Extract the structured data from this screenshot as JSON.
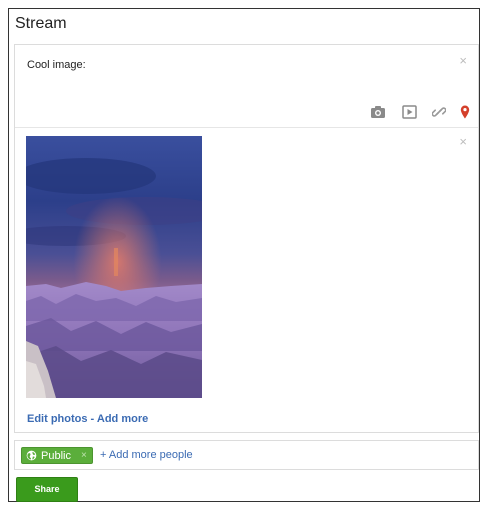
{
  "stream": {
    "title": "Stream"
  },
  "composer": {
    "text": "Cool image:",
    "close_glyph": "×",
    "tools": [
      {
        "name": "camera-icon"
      },
      {
        "name": "video-icon"
      },
      {
        "name": "link-icon"
      },
      {
        "name": "location-pin-icon"
      }
    ]
  },
  "attachment": {
    "close_glyph": "×",
    "image": "grand-canyon-sunset-photo",
    "edit_label": "Edit photos",
    "separator": " - ",
    "add_more_label": "Add more"
  },
  "audience": {
    "chip_label": "Public",
    "chip_remove_glyph": "×",
    "add_people_label": "+ Add more people"
  },
  "share_button": {
    "label": "Share"
  },
  "colors": {
    "link": "#3b6bb3",
    "chip_green": "#5bae3b",
    "share_green": "#3a9b1c",
    "pin_red": "#d4402b",
    "icon_gray": "#8a8a8a"
  }
}
